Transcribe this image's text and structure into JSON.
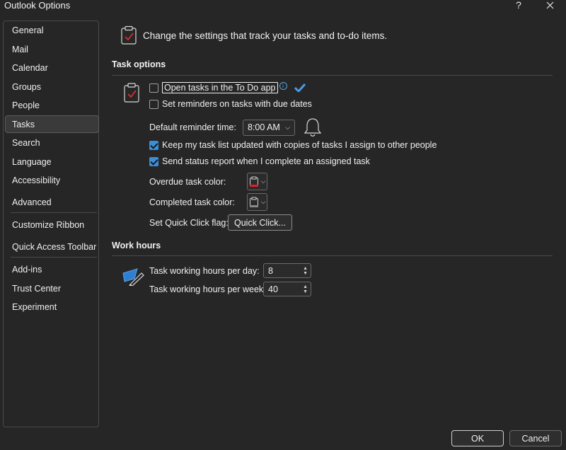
{
  "window": {
    "title": "Outlook Options",
    "help_label": "?"
  },
  "sidebar": {
    "items": [
      {
        "label": "General"
      },
      {
        "label": "Mail"
      },
      {
        "label": "Calendar"
      },
      {
        "label": "Groups"
      },
      {
        "label": "People"
      },
      {
        "label": "Tasks",
        "selected": true
      },
      {
        "label": "Search"
      },
      {
        "label": "Language"
      },
      {
        "label": "Accessibility"
      },
      {
        "label": "Advanced"
      },
      {
        "label": "Customize Ribbon"
      },
      {
        "label": "Quick Access Toolbar"
      },
      {
        "label": "Add-ins"
      },
      {
        "label": "Trust Center"
      },
      {
        "label": "Experiment"
      }
    ]
  },
  "header": {
    "text": "Change the settings that track your tasks and to-do items."
  },
  "task_options": {
    "title": "Task options",
    "open_todo": {
      "label": "Open tasks in the To Do app",
      "checked": false
    },
    "set_reminders": {
      "label": "Set reminders on tasks with due dates",
      "checked": false
    },
    "default_reminder_label": "Default reminder time:",
    "default_reminder_value": "8:00 AM",
    "keep_updated": {
      "label": "Keep my task list updated with copies of tasks I assign to other people",
      "checked": true
    },
    "send_status": {
      "label": "Send status report when I complete an assigned task",
      "checked": true
    },
    "overdue_color_label": "Overdue task color:",
    "overdue_color": "#e0202a",
    "completed_color_label": "Completed task color:",
    "completed_color": "#8a8a8a",
    "quick_click_label": "Set Quick Click flag:",
    "quick_click_button": "Quick Click..."
  },
  "work_hours": {
    "title": "Work hours",
    "per_day_label": "Task working hours per day:",
    "per_day_value": "8",
    "per_week_label": "Task working hours per week:",
    "per_week_value": "40"
  },
  "footer": {
    "ok": "OK",
    "cancel": "Cancel"
  },
  "colors": {
    "background": "#262626",
    "accent": "#3b8ed8",
    "selected_nav": "#3a3a3a"
  }
}
